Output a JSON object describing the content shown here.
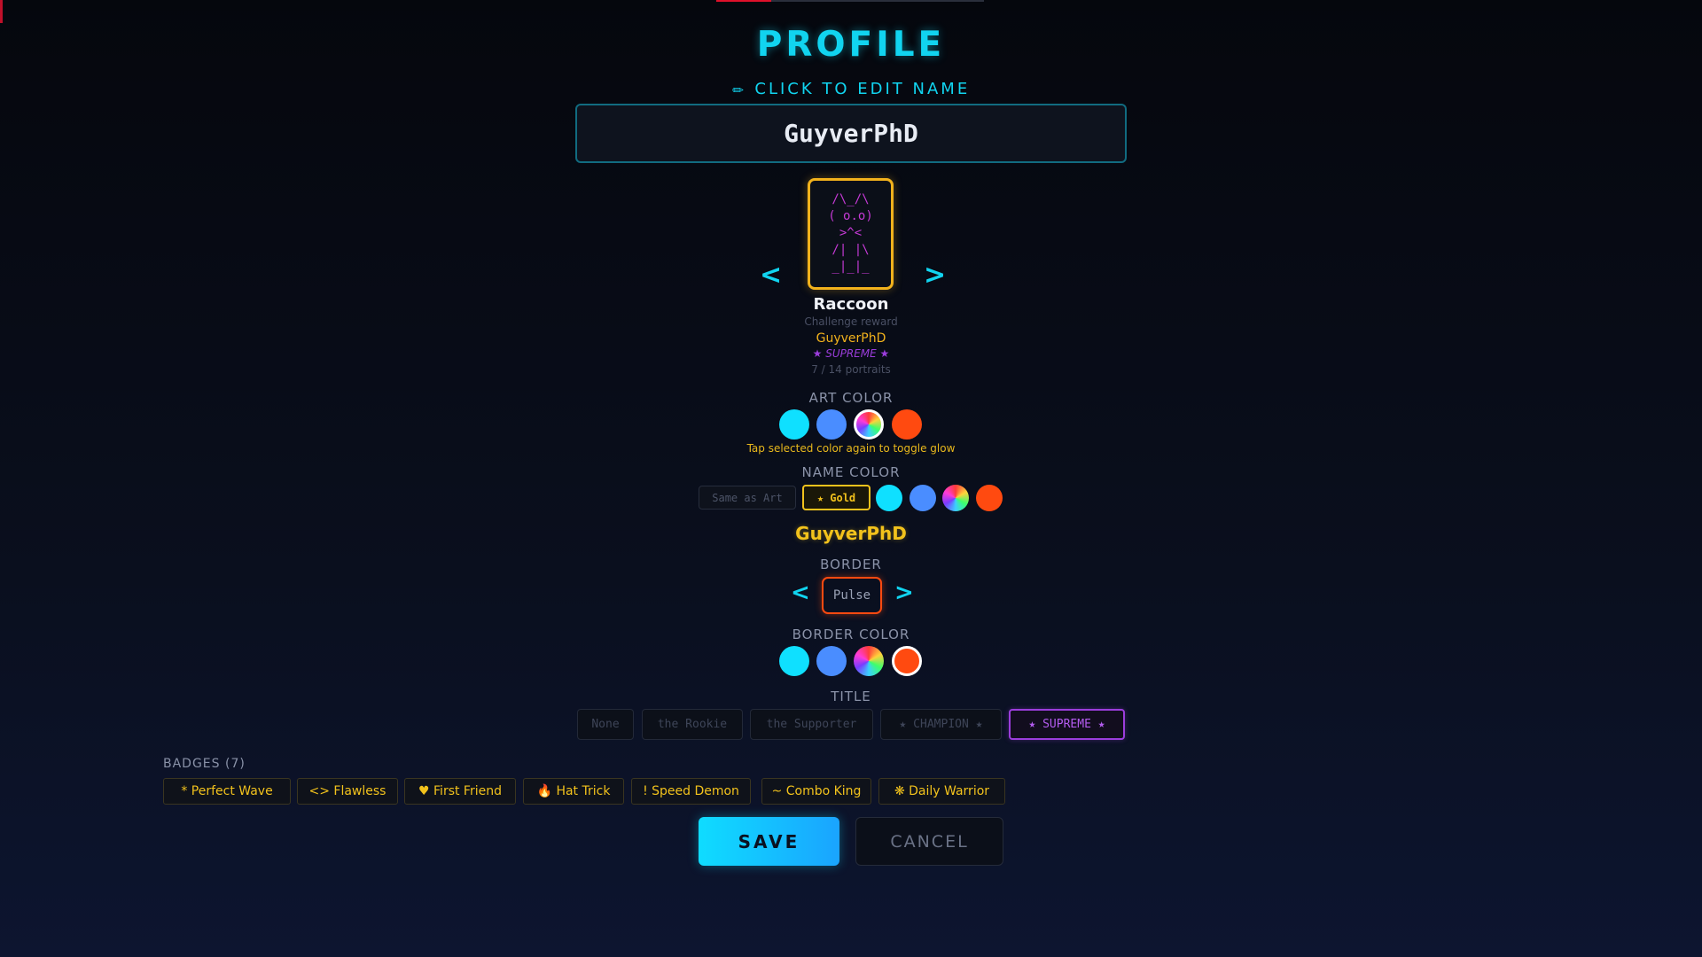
{
  "header": {
    "title": "PROFILE",
    "edit_hint": "CLICK TO EDIT NAME",
    "edit_icon": "pencil-icon"
  },
  "name_input": {
    "value": "GuyverPhD"
  },
  "portrait": {
    "prev_label": "<",
    "next_label": ">",
    "art": "/\\_/\\\n( o.o)\n >^< \n/| |\\\n_|_|_",
    "name": "Raccoon",
    "source": "Challenge reward",
    "owner": "GuyverPhD",
    "rank": "★ SUPREME ★",
    "count": "7 / 14 portraits"
  },
  "art_color": {
    "label": "ART COLOR",
    "swatches": [
      "#0fe0ff",
      "#4a8dff",
      "rainbow",
      "#ff4a10"
    ],
    "selected": "rainbow",
    "hint": "Tap selected color again to toggle glow"
  },
  "name_color": {
    "label": "NAME COLOR",
    "same_as_art": "Same as Art",
    "gold": "★ Gold",
    "selected": "Gold",
    "swatches": [
      "#0fe0ff",
      "#4a8dff",
      "rainbow",
      "#ff4a10"
    ],
    "preview": "GuyverPhD"
  },
  "border": {
    "label": "BORDER",
    "prev_label": "<",
    "next_label": ">",
    "style": "Pulse"
  },
  "border_color": {
    "label": "BORDER COLOR",
    "swatches": [
      "#0fe0ff",
      "#4a8dff",
      "rainbow",
      "#ff4a10"
    ],
    "selected": "#ff4a10"
  },
  "title_section": {
    "label": "TITLE",
    "options": [
      "None",
      "the Rookie",
      "the Supporter",
      "★ CHAMPION ★",
      "★ SUPREME ★"
    ],
    "selected": "★ SUPREME ★"
  },
  "badges": {
    "label": "BADGES (7)",
    "items": [
      "* Perfect Wave",
      "<> Flawless",
      "♥ First Friend",
      "🔥 Hat Trick",
      "! Speed Demon",
      "~ Combo King",
      "❋ Daily Warrior"
    ]
  },
  "actions": {
    "save": "SAVE",
    "cancel": "CANCEL"
  },
  "colors": {
    "accent": "#11d4f0",
    "gold": "#f2c21c",
    "purple": "#9b3ddc",
    "orange": "#ff4a10"
  }
}
